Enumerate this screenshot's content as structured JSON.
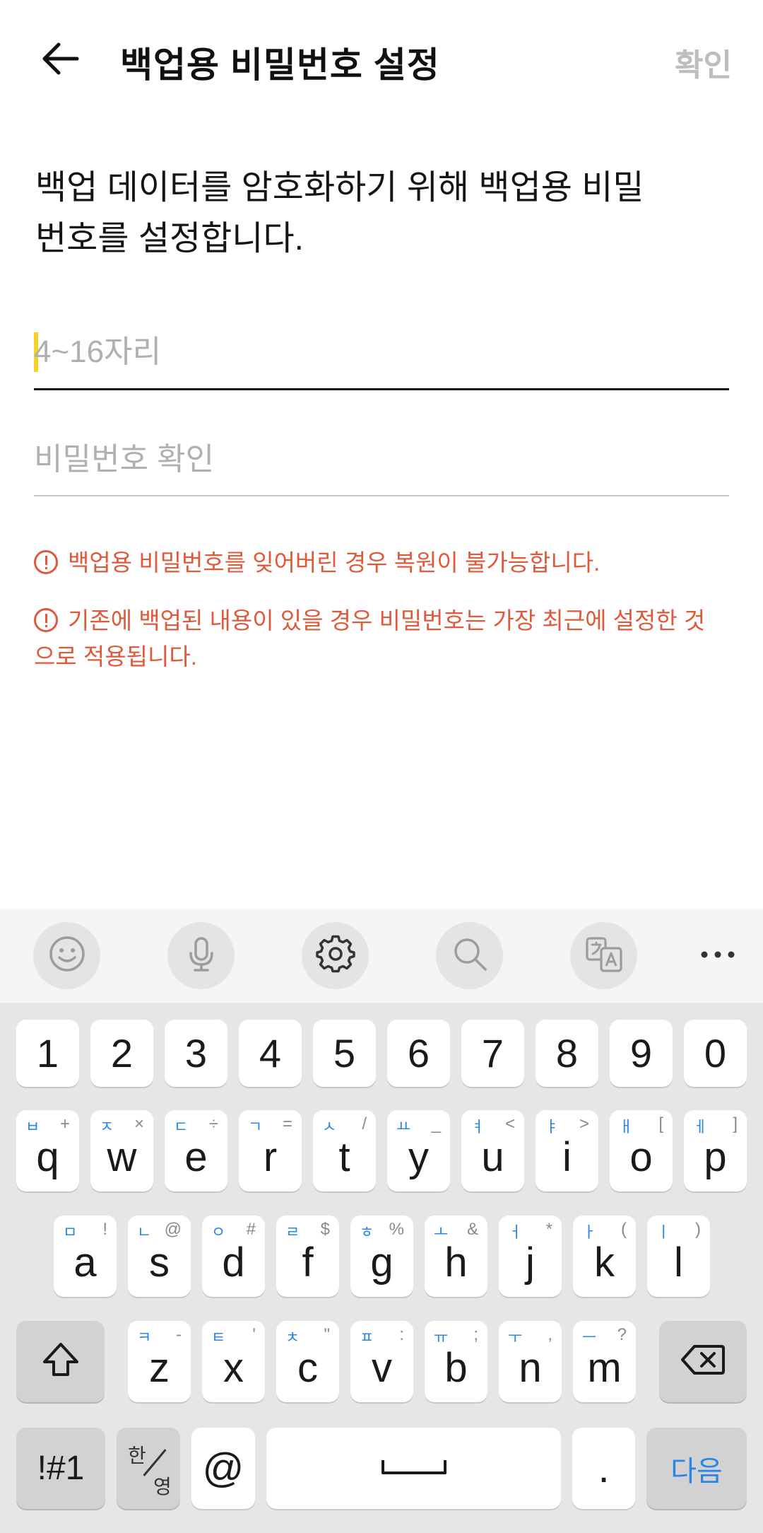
{
  "header": {
    "title": "백업용 비밀번호 설정",
    "confirm_label": "확인"
  },
  "description": "백업 데이터를 암호화하기 위해 백업용 비밀번호를 설정합니다.",
  "fields": {
    "password_placeholder": "4~16자리",
    "password_value": "",
    "confirm_placeholder": "비밀번호 확인",
    "confirm_value": ""
  },
  "warnings": [
    "백업용 비밀번호를 잊어버린 경우 복원이 불가능합니다.",
    "기존에 백업된 내용이 있을 경우 비밀번호는 가장 최근에 설정한 것으로 적용됩니다."
  ],
  "colors": {
    "warning": "#e0593a",
    "accent": "#2a86e6",
    "cursor": "#f5d22a",
    "disabled": "#bdbdbd"
  },
  "keyboard": {
    "toolbar_icons": [
      "emoji-icon",
      "microphone-icon",
      "settings-icon",
      "search-icon",
      "translate-icon",
      "more-icon"
    ],
    "numbers": [
      "1",
      "2",
      "3",
      "4",
      "5",
      "6",
      "7",
      "8",
      "9",
      "0"
    ],
    "row1": [
      {
        "key": "q",
        "hangul": "ㅂ",
        "symbol": "+"
      },
      {
        "key": "w",
        "hangul": "ㅈ",
        "symbol": "×"
      },
      {
        "key": "e",
        "hangul": "ㄷ",
        "symbol": "÷"
      },
      {
        "key": "r",
        "hangul": "ㄱ",
        "symbol": "="
      },
      {
        "key": "t",
        "hangul": "ㅅ",
        "symbol": "/"
      },
      {
        "key": "y",
        "hangul": "ㅛ",
        "symbol": "_"
      },
      {
        "key": "u",
        "hangul": "ㅕ",
        "symbol": "<"
      },
      {
        "key": "i",
        "hangul": "ㅑ",
        "symbol": ">"
      },
      {
        "key": "o",
        "hangul": "ㅐ",
        "symbol": "["
      },
      {
        "key": "p",
        "hangul": "ㅔ",
        "symbol": "]"
      }
    ],
    "row2": [
      {
        "key": "a",
        "hangul": "ㅁ",
        "symbol": "!"
      },
      {
        "key": "s",
        "hangul": "ㄴ",
        "symbol": "@"
      },
      {
        "key": "d",
        "hangul": "ㅇ",
        "symbol": "#"
      },
      {
        "key": "f",
        "hangul": "ㄹ",
        "symbol": "$"
      },
      {
        "key": "g",
        "hangul": "ㅎ",
        "symbol": "%"
      },
      {
        "key": "h",
        "hangul": "ㅗ",
        "symbol": "&"
      },
      {
        "key": "j",
        "hangul": "ㅓ",
        "symbol": "*"
      },
      {
        "key": "k",
        "hangul": "ㅏ",
        "symbol": "("
      },
      {
        "key": "l",
        "hangul": "ㅣ",
        "symbol": ")"
      }
    ],
    "row3": [
      {
        "key": "z",
        "hangul": "ㅋ",
        "symbol": "-"
      },
      {
        "key": "x",
        "hangul": "ㅌ",
        "symbol": "'"
      },
      {
        "key": "c",
        "hangul": "ㅊ",
        "symbol": "\""
      },
      {
        "key": "v",
        "hangul": "ㅍ",
        "symbol": ":"
      },
      {
        "key": "b",
        "hangul": "ㅠ",
        "symbol": ";"
      },
      {
        "key": "n",
        "hangul": "ㅜ",
        "symbol": ","
      },
      {
        "key": "m",
        "hangul": "ㅡ",
        "symbol": "?"
      }
    ],
    "symbols_label": "!#1",
    "lang_top": "한",
    "lang_bottom": "영",
    "at_label": "@",
    "period_label": ".",
    "enter_label": "다음"
  }
}
